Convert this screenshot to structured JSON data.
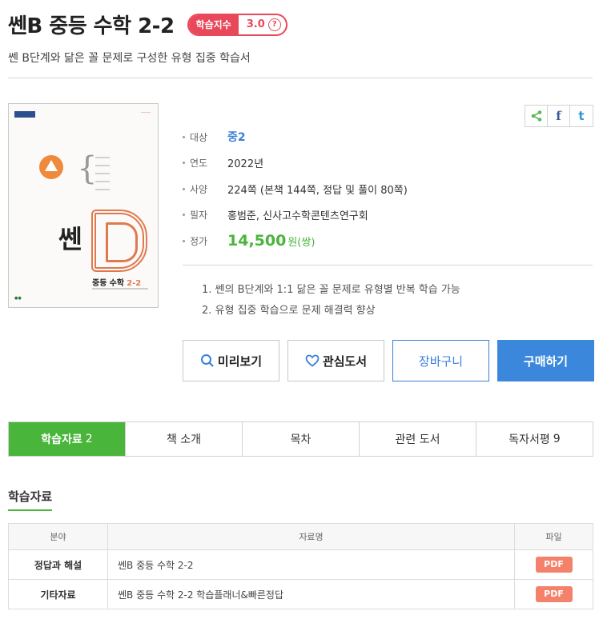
{
  "title": "쎈B 중등 수학 2-2",
  "index_badge": {
    "label": "학습지수",
    "value": "3.0",
    "help": "?"
  },
  "subtitle": "쎈 B단계와 닮은 꼴 문제로 구성한 유형 집중 학습서",
  "cover": {
    "brand": "쎈",
    "caption_prefix": "중등",
    "caption_subject": "수학",
    "caption_grade": "2-2"
  },
  "share": {
    "share_icon": "share-icon",
    "facebook": "f",
    "twitter": "t"
  },
  "info": [
    {
      "key": "대상",
      "value": "중2"
    },
    {
      "key": "연도",
      "value": "2022년"
    },
    {
      "key": "사양",
      "value": "224쪽 (본책 144쪽, 정답 및 풀이 80쪽)"
    },
    {
      "key": "필자",
      "value": "홍범준, 신사고수학콘텐츠연구회"
    },
    {
      "key": "정가",
      "value": "14,500",
      "unit": "원(쌍)"
    }
  ],
  "features": [
    "1. 쎈의 B단계와 1:1 닮은 꼴 문제로 유형별 반복 학습 가능",
    "2. 유형 집중 학습으로 문제 해결력 향상"
  ],
  "buttons": {
    "preview": "미리보기",
    "wishlist": "관심도서",
    "cart": "장바구니",
    "buy": "구매하기"
  },
  "tabs": [
    {
      "label": "학습자료",
      "count": "2"
    },
    {
      "label": "책 소개",
      "count": ""
    },
    {
      "label": "목차",
      "count": ""
    },
    {
      "label": "관련 도서",
      "count": ""
    },
    {
      "label": "독자서평",
      "count": "9"
    }
  ],
  "section_title": "학습자료",
  "table": {
    "headers": [
      "분야",
      "자료명",
      "파일"
    ],
    "rows": [
      {
        "category": "정답과 해설",
        "name": "쎈B 중등 수학 2-2",
        "file": "PDF"
      },
      {
        "category": "기타자료",
        "name": "쎈B 중등 수학 2-2 학습플래너&빠른정답",
        "file": "PDF"
      }
    ]
  },
  "colors": {
    "accent_green": "#4ab53b",
    "accent_blue": "#3a87db",
    "badge_red": "#e8485a",
    "pdf_orange": "#f4826a"
  }
}
